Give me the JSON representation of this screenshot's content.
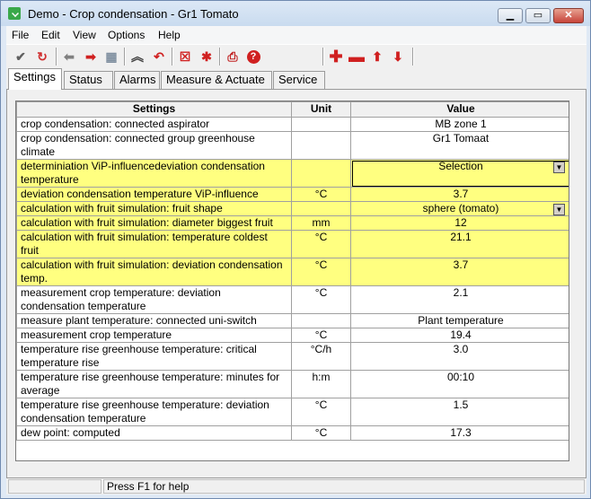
{
  "window": {
    "title": "Demo - Crop condensation - Gr1 Tomato"
  },
  "menu": [
    "File",
    "Edit",
    "View",
    "Options",
    "Help"
  ],
  "toolbar": {
    "buttons": [
      "check-icon",
      "refresh-icon",
      "arrow-left-icon",
      "arrow-right-icon",
      "grid-icon",
      "collapse-icon",
      "undo-icon",
      "delete-icon",
      "asterisk-icon",
      "print-icon",
      "help-icon",
      "add-icon",
      "remove-icon",
      "move-up-icon",
      "move-down-icon"
    ]
  },
  "tabs": [
    "Settings",
    "Status",
    "Alarms",
    "Measure & Actuate",
    "Service"
  ],
  "grid": {
    "headers": {
      "settings": "Settings",
      "unit": "Unit",
      "value": "Value"
    },
    "rows": [
      {
        "setting": "crop condensation: connected aspirator",
        "unit": "",
        "value": "MB zone 1",
        "yellow": false
      },
      {
        "setting": "crop condensation: connected group greenhouse climate",
        "unit": "",
        "value": "Gr1 Tomaat",
        "yellow": false
      },
      {
        "setting": "determiniation ViP-influencedeviation condensation temperature",
        "unit": "",
        "value": "Selection",
        "yellow": true,
        "dropdown": true,
        "selected": true
      },
      {
        "setting": "deviation condensation temperature ViP-influence",
        "unit": "°C",
        "value": "3.7",
        "yellow": true
      },
      {
        "setting": "calculation with fruit simulation: fruit shape",
        "unit": "",
        "value": "sphere (tomato)",
        "yellow": true,
        "dropdown": true
      },
      {
        "setting": "calculation with fruit simulation: diameter biggest fruit",
        "unit": "mm",
        "value": "12",
        "yellow": true
      },
      {
        "setting": "calculation with fruit simulation: temperature coldest fruit",
        "unit": "°C",
        "value": "21.1",
        "yellow": true
      },
      {
        "setting": "calculation with fruit simulation: deviation condensation temp.",
        "unit": "°C",
        "value": "3.7",
        "yellow": true
      },
      {
        "setting": "measurement crop temperature: deviation condensation temperature",
        "unit": "°C",
        "value": "2.1",
        "yellow": false
      },
      {
        "setting": "measure plant temperature: connected uni-switch",
        "unit": "",
        "value": "Plant temperature",
        "yellow": false
      },
      {
        "setting": "measurement crop temperature",
        "unit": "°C",
        "value": "19.4",
        "yellow": false
      },
      {
        "setting": "temperature rise greenhouse temperature: critical temperature rise",
        "unit": "°C/h",
        "value": "3.0",
        "yellow": false
      },
      {
        "setting": "temperature rise greenhouse temperature: minutes for average",
        "unit": "h:m",
        "value": "00:10",
        "yellow": false
      },
      {
        "setting": "temperature rise greenhouse temperature: deviation condensation temperature",
        "unit": "°C",
        "value": "1.5",
        "yellow": false
      },
      {
        "setting": "dew point: computed",
        "unit": "°C",
        "value": "17.3",
        "yellow": false
      }
    ]
  },
  "status": {
    "text": "Press F1 for help"
  }
}
